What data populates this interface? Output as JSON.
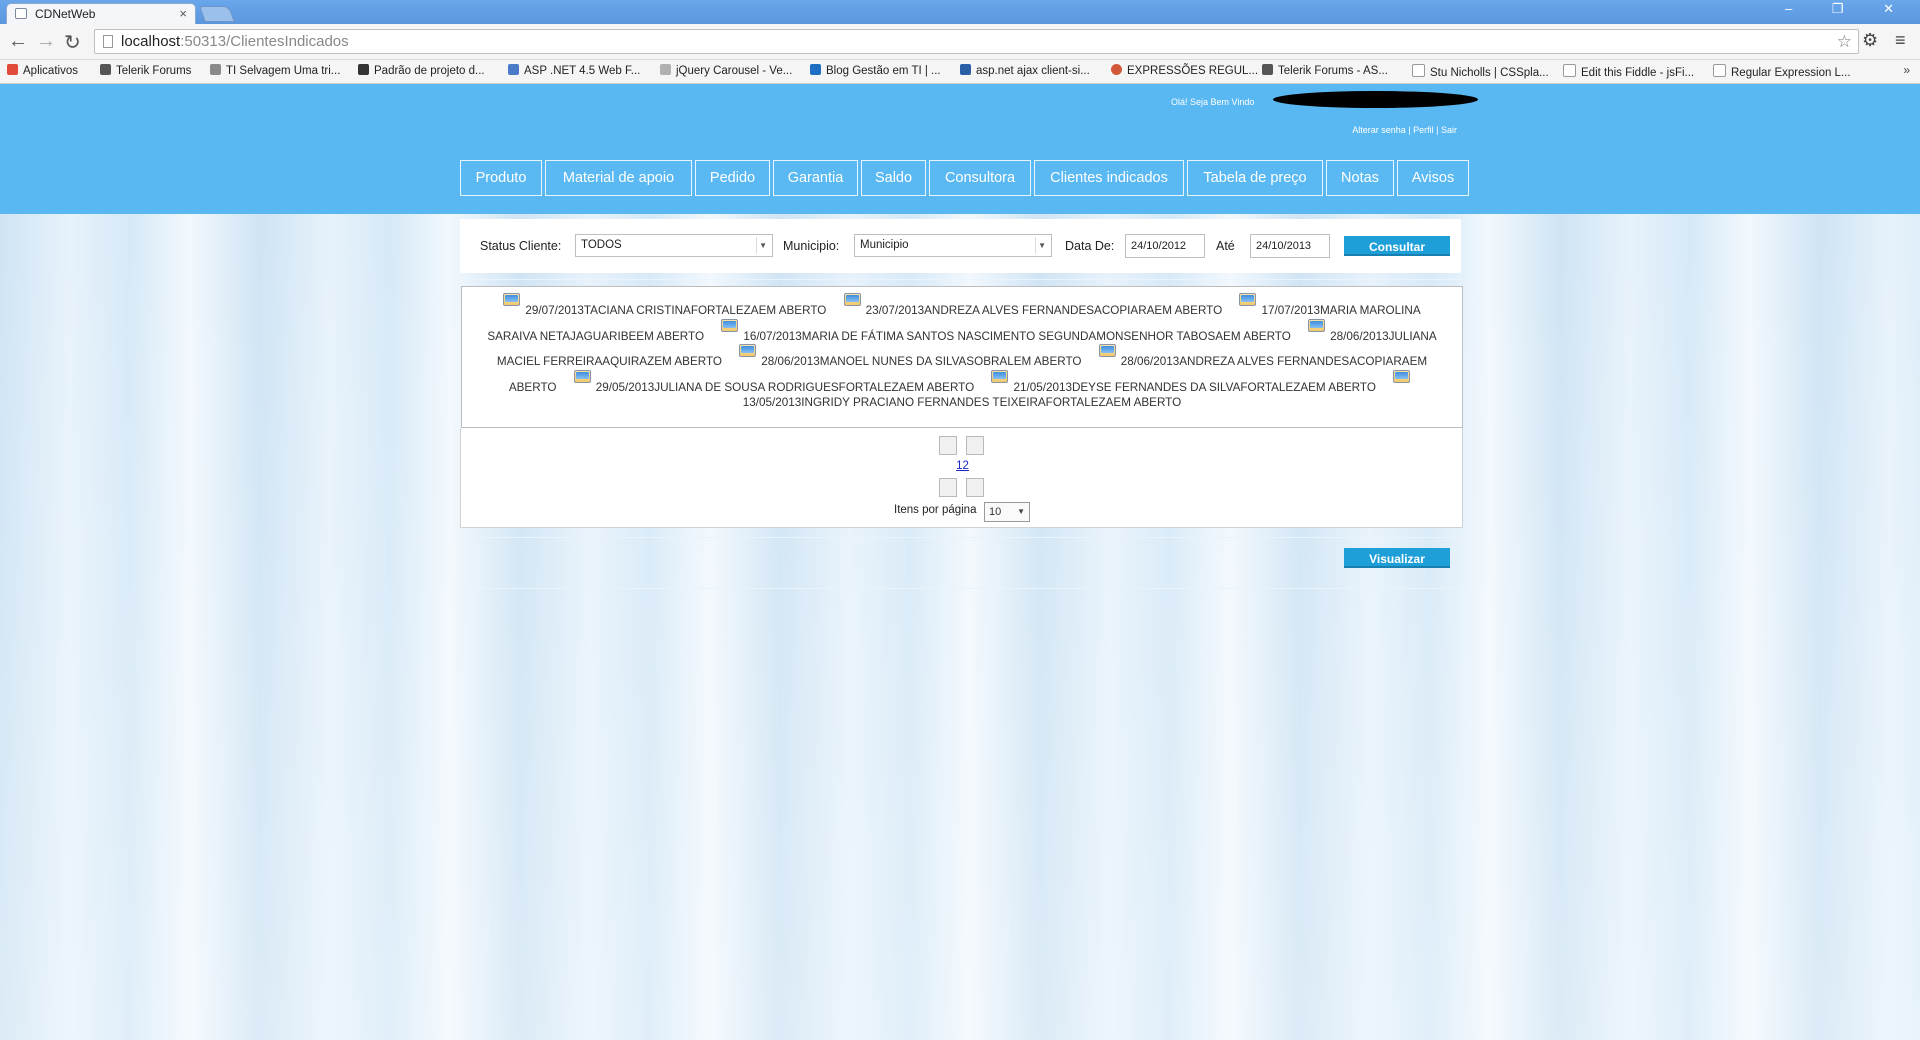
{
  "browser": {
    "tab_title": "CDNetWeb",
    "tab_close": "×",
    "window_controls": "– ❐ ✕",
    "url_host": "localhost",
    "url_rest": ":50313/ClientesIndicados",
    "back": "←",
    "forward": "→",
    "reload": "↻",
    "star": "☆",
    "settings": "⚙",
    "menu": "≡",
    "bookmarks_more": "»",
    "bookmarks": [
      {
        "label": "Aplicativos",
        "color": "#e14b3a"
      },
      {
        "label": "Telerik Forums",
        "color": "#555555"
      },
      {
        "label": "TI Selvagem Uma tri...",
        "color": "#8a8a8a"
      },
      {
        "label": "Padrão de projeto d...",
        "color": "#333333"
      },
      {
        "label": "ASP .NET 4.5 Web F...",
        "color": "#4a7bc8"
      },
      {
        "label": "jQuery Carousel - Ve...",
        "color": "#b0b0b0"
      },
      {
        "label": "Blog Gestão em TI | ...",
        "color": "#1e6fc2"
      },
      {
        "label": "asp.net ajax client-si...",
        "color": "#2a5fa8"
      },
      {
        "label": "EXPRESSÕES REGUL...",
        "color": "#d2583a"
      },
      {
        "label": "Telerik Forums - AS...",
        "color": "#555555"
      },
      {
        "label": "Stu Nicholls | CSSpla...",
        "color": "#cccccc"
      },
      {
        "label": "Edit this Fiddle - jsFi...",
        "color": "#cccccc"
      },
      {
        "label": "Regular Expression L...",
        "color": "#cccccc"
      }
    ]
  },
  "header": {
    "welcome": "Olá! Seja Bem Vindo",
    "links": [
      "Alterar senha",
      "Perfil",
      "Sair"
    ],
    "separator": " | ",
    "nav": [
      "Produto",
      "Material de apoio",
      "Pedido",
      "Garantia",
      "Saldo",
      "Consultora",
      "Clientes indicados",
      "Tabela de preço",
      "Notas",
      "Avisos"
    ]
  },
  "filters": {
    "status_label": "Status Cliente:",
    "status_value": "TODOS",
    "municipio_label": "Municipio:",
    "municipio_value": "Municipio",
    "data_de_label": "Data De:",
    "data_de_value": "24/10/2012",
    "ate_label": "Até",
    "ate_value": "24/10/2013",
    "consultar": "Consultar",
    "caret": "▼"
  },
  "records": [
    "29/07/2013TACIANA CRISTINAFORTALEZAEM ABERTO",
    "23/07/2013ANDREZA ALVES FERNANDESACOPIARAEM ABERTO",
    "17/07/2013MARIA MAROLINA SARAIVA NETAJAGUARIBEEM ABERTO",
    "16/07/2013MARIA DE FÁTIMA SANTOS NASCIMENTO SEGUNDAMONSENHOR TABOSAEM ABERTO",
    "28/06/2013JULIANA MACIEL FERREIRAAQUIRAZEM ABERTO",
    "28/06/2013MANOEL NUNES DA SILVASOBRALEM ABERTO",
    "28/06/2013ANDREZA ALVES FERNANDESACOPIARAEM ABERTO",
    "29/05/2013JULIANA DE SOUSA RODRIGUESFORTALEZAEM ABERTO",
    "21/05/2013DEYSE FERNANDES DA SILVAFORTALEZAEM ABERTO",
    "13/05/2013INGRIDY PRACIANO FERNANDES TEIXEIRAFORTALEZAEM ABERTO"
  ],
  "pager": {
    "pages": [
      "1",
      "2"
    ],
    "items_label": "Itens por página",
    "items_value": "10",
    "caret": "▼"
  },
  "actions": {
    "visualizar": "Visualizar"
  },
  "colors": {
    "header_bg": "#59b8f1",
    "button_blue": "#1f9fd8",
    "link_blue": "#1a27c8"
  }
}
